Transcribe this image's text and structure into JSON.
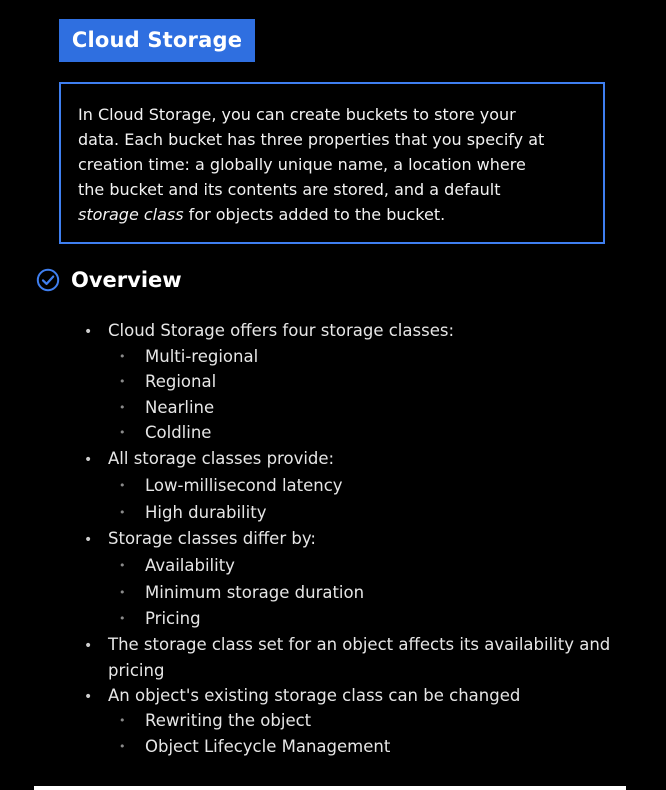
{
  "title": "Cloud Storage",
  "intro": {
    "lines": [
      "In Cloud Storage, you can create buckets to store your",
      "data. Each bucket has three properties that you specify at",
      "creation time: a globally unique name, a location where",
      "the bucket and its contents are stored, and a default"
    ],
    "last_line_italic": "storage class",
    "last_line_rest": " for objects added to the bucket."
  },
  "overview": {
    "icon": "check-circle-icon",
    "heading": "Overview",
    "accent_color": "#3f7ff0"
  },
  "bullets": [
    {
      "text": "Cloud Storage offers four storage classes:",
      "children": [
        "Multi-regional",
        "Regional",
        "Nearline",
        "Coldline"
      ]
    },
    {
      "text": "All storage classes provide:",
      "children": [
        "Low-millisecond latency",
        "High durability"
      ]
    },
    {
      "text": "Storage classes differ by:",
      "children": [
        "Availability",
        "Minimum storage duration",
        "Pricing"
      ]
    },
    {
      "text_lines": [
        "The storage class set for an object affects its availability and",
        "pricing"
      ],
      "children": []
    },
    {
      "text": "An object's existing storage class can be changed",
      "children": [
        "Rewriting the object",
        "Object Lifecycle Management"
      ]
    }
  ],
  "colors": {
    "background": "#000000",
    "title_badge": "#2f6fe0",
    "box_border": "#3f7ff0"
  }
}
